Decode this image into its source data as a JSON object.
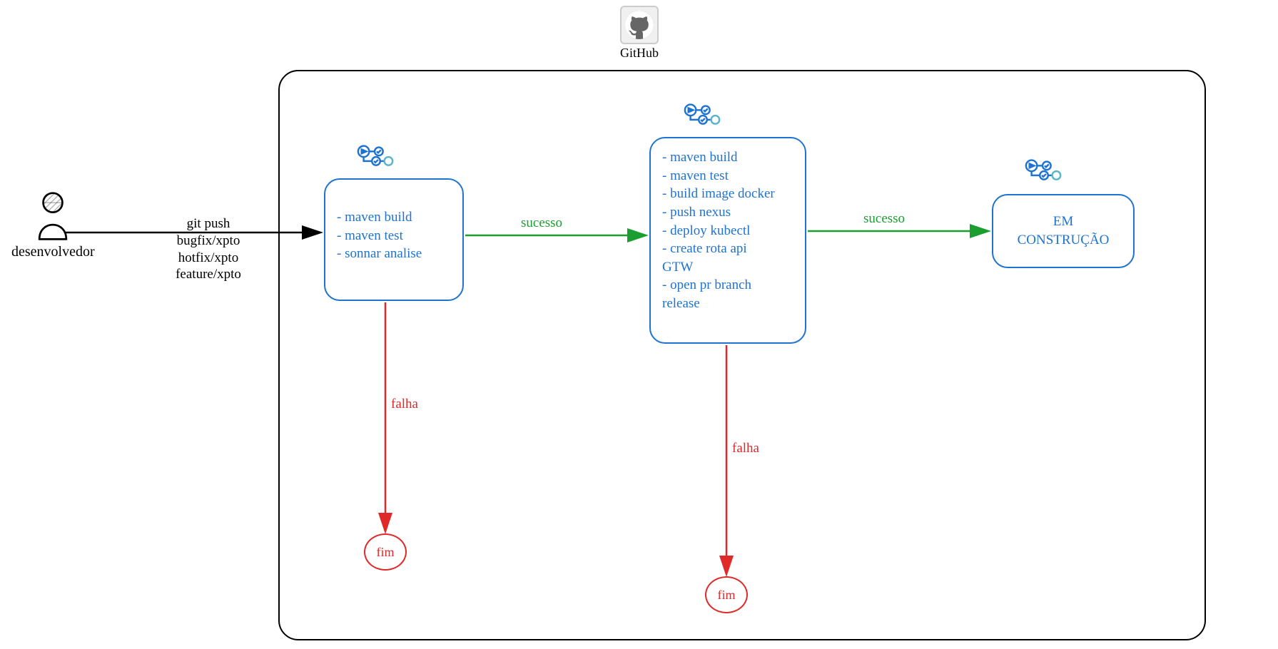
{
  "github": {
    "label": "GitHub"
  },
  "actor": {
    "label": "desenvolvedor"
  },
  "push": {
    "title": "git push",
    "branches": [
      "bugfix/xpto",
      "hotfix/xpto",
      "feature/xpto"
    ]
  },
  "step1": {
    "items": [
      "- maven build",
      "- maven test",
      "- sonnar analise"
    ]
  },
  "step2": {
    "items": [
      "- maven build",
      "- maven test",
      "- build image docker",
      "- push nexus",
      "- deploy kubectl",
      "- create rota api",
      "GTW",
      "- open pr branch",
      "release"
    ]
  },
  "step3": {
    "text1": "EM",
    "text2": "CONSTRUÇÃO"
  },
  "labels": {
    "sucesso": "sucesso",
    "falha": "falha",
    "fim": "fim"
  },
  "colors": {
    "blue": "#1e73d2",
    "green": "#1a9e2f",
    "red": "#e02a2a",
    "black": "#000000"
  }
}
